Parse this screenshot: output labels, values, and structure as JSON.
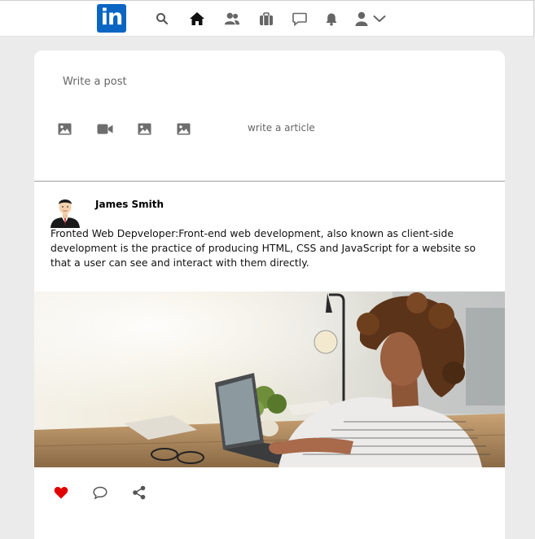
{
  "nav": {
    "logo_text": "in",
    "icons": [
      "search-icon",
      "home-icon",
      "people-icon",
      "briefcase-icon",
      "chat-icon",
      "bell-icon",
      "user-icon",
      "chevron-down-icon"
    ]
  },
  "composer": {
    "placeholder": "Write a post",
    "tools": [
      "image-icon",
      "video-icon",
      "image-icon",
      "image-icon"
    ],
    "article_label": "write a article"
  },
  "post": {
    "author": "James Smith",
    "text": "Fronted Web Depveloper:Front-end web development, also known as client-side development is the practice of producing HTML, CSS and JavaScript for a website so that a user can see and interact with them directly.",
    "image_alt": "Woman working on laptop",
    "actions": [
      "heart-icon",
      "comment-icon",
      "share-icon"
    ]
  },
  "colors": {
    "brand": "#0a66c2",
    "like": "#e00000",
    "background": "#ebebeb"
  }
}
